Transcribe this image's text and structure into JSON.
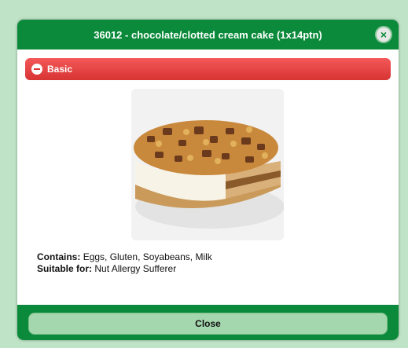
{
  "dialog": {
    "title": "36012 - chocolate/clotted cream cake (1x14ptn)",
    "close_icon": "close-x-icon"
  },
  "section": {
    "label": "Basic",
    "icon": "minus-circle-icon",
    "color": "#d83434"
  },
  "product": {
    "image_alt": "chocolate/clotted cream cake",
    "contains_label": "Contains:",
    "contains_value": "Eggs, Gluten, Soyabeans, Milk",
    "suitable_label": "Suitable for:",
    "suitable_value": "Nut Allergy Sufferer"
  },
  "footer": {
    "close_label": "Close"
  },
  "colors": {
    "title_bar": "#0a8a3a",
    "section_bar": "#d83434",
    "button": "#a4d7ad"
  }
}
